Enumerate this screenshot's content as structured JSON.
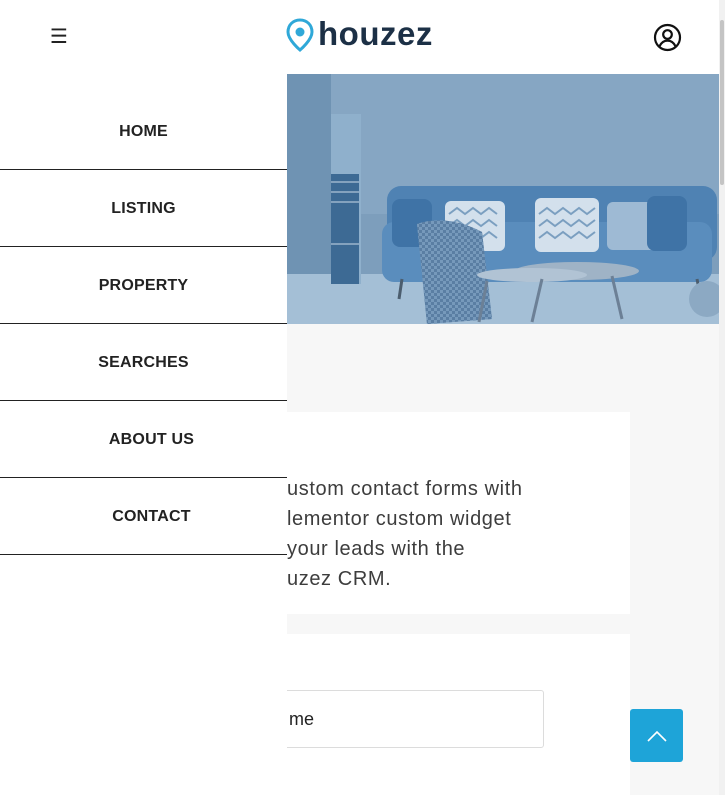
{
  "header": {
    "menu_icon": "hamburger-icon",
    "menu_glyph": "☰",
    "logo_text": "houzez",
    "logo_icon": "location-pin-icon",
    "user_icon": "user-account-icon"
  },
  "nav": {
    "items": [
      {
        "label": "HOME"
      },
      {
        "label": "LISTING"
      },
      {
        "label": "PROPERTY"
      },
      {
        "label": "SEARCHES"
      },
      {
        "label": "ABOUT US"
      },
      {
        "label": "CONTACT"
      }
    ]
  },
  "content": {
    "lines": [
      "ustom contact forms with",
      "lementor custom widget",
      "your leads with the",
      "uzez CRM."
    ]
  },
  "form": {
    "name_placeholder": "me"
  },
  "back_to_top": {
    "icon": "chevron-up-icon"
  },
  "colors": {
    "accent": "#1ea4d8",
    "brand_dark": "#1c3046",
    "logo_pin": "#2fa8d8",
    "hero_tint": "#7c9dbb"
  }
}
